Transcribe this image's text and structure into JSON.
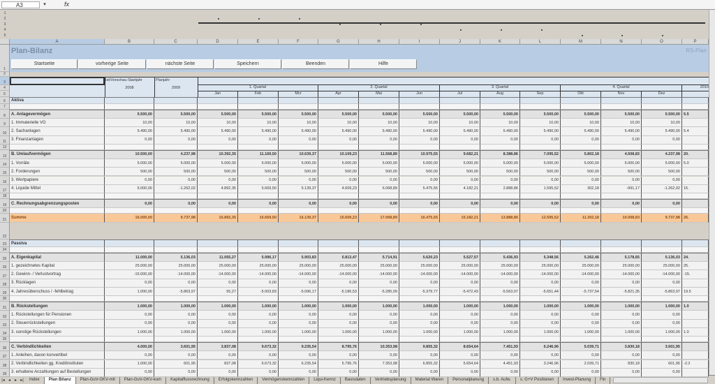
{
  "formula_bar": {
    "cell_ref": "A3",
    "dropdown_icon": "chevron-down-icon",
    "fx_label": "fx"
  },
  "outline_levels": [
    "1",
    "2",
    "3",
    "4",
    "5"
  ],
  "columns": [
    "A",
    "B",
    "C",
    "D",
    "E",
    "F",
    "G",
    "H",
    "I",
    "J",
    "K",
    "L",
    "M",
    "N",
    "O",
    "P"
  ],
  "sheet": {
    "title": "Plan-Bilanz",
    "brand": "RS-Plan",
    "buttons": [
      "Startseite",
      "vorherige Seite",
      "nächste Seite",
      "Speichern",
      "Beenden",
      "Hilfe"
    ],
    "header": {
      "col_b": "Ist/Vorschau-Startjahr",
      "col_b_year": "2008",
      "col_c": "Planjahr",
      "col_c_year": "2009",
      "quarters": [
        "1. Quartal",
        "2. Quartal",
        "3. Quartal",
        "4. Quartal"
      ],
      "months": [
        "Jan",
        "Feb",
        "Mrz",
        "Apr",
        "Mai",
        "Jun",
        "Jul",
        "Aug",
        "Sep",
        "Okt",
        "Nov",
        "Dez"
      ],
      "next_year": "2010"
    }
  },
  "rows": [
    {
      "n": "6",
      "label": "Aktiva",
      "type": "sec-title"
    },
    {
      "n": "7",
      "type": "blank"
    },
    {
      "n": "8",
      "label": "A. Anlagevermögen",
      "type": "sec",
      "values": [
        "5.500,00",
        "5.500,00",
        "5.500,00",
        "5.500,00",
        "5.500,00",
        "5.500,00",
        "5.500,00",
        "5.500,00",
        "5.500,00",
        "5.500,00",
        "5.500,00",
        "5.500,00",
        "5.500,00",
        "5.500,00"
      ],
      "p": "5.5"
    },
    {
      "n": "9",
      "label": "1. Immaterielle VG",
      "type": "plain",
      "values": [
        "10,00",
        "10,00",
        "10,00",
        "10,00",
        "10,00",
        "10,00",
        "10,00",
        "10,00",
        "10,00",
        "10,00",
        "10,00",
        "10,00",
        "10,00",
        "10,00"
      ],
      "p": ""
    },
    {
      "n": "10",
      "label": "2. Sachanlagen",
      "type": "plain",
      "values": [
        "5.490,00",
        "5.490,00",
        "5.490,00",
        "5.490,00",
        "5.490,00",
        "5.490,00",
        "5.490,00",
        "5.490,00",
        "5.490,00",
        "5.490,00",
        "5.490,00",
        "5.490,00",
        "5.490,00",
        "5.490,00"
      ],
      "p": "5.4"
    },
    {
      "n": "11",
      "label": "3. Finanzanlagen",
      "type": "plain",
      "values": [
        "0,00",
        "0,00",
        "0,00",
        "0,00",
        "0,00",
        "0,00",
        "0,00",
        "0,00",
        "0,00",
        "0,00",
        "0,00",
        "0,00",
        "0,00",
        "0,00"
      ],
      "p": ""
    },
    {
      "n": "12",
      "type": "blank"
    },
    {
      "n": "13",
      "label": "B. Umlaufvermögen",
      "type": "sec",
      "values": [
        "10.500,00",
        "4.237,98",
        "10.392,35",
        "11.169,50",
        "10.639,37",
        "10.109,23",
        "11.568,89",
        "10.975,55",
        "9.682,21",
        "8.388,86",
        "7.095,52",
        "5.802,18",
        "4.508,83",
        "4.237,98"
      ],
      "p": "20."
    },
    {
      "n": "14",
      "label": "1. Vorräte",
      "type": "plain",
      "values": [
        "5.000,00",
        "5.000,00",
        "5.000,00",
        "5.000,00",
        "5.000,00",
        "5.000,00",
        "5.000,00",
        "5.000,00",
        "5.000,00",
        "5.000,00",
        "5.000,00",
        "5.000,00",
        "5.000,00",
        "5.000,00"
      ],
      "p": "5.0"
    },
    {
      "n": "15",
      "label": "2. Forderungen",
      "type": "plain",
      "values": [
        "500,00",
        "500,00",
        "500,00",
        "500,00",
        "500,00",
        "500,00",
        "500,00",
        "500,00",
        "500,00",
        "500,00",
        "500,00",
        "500,00",
        "500,00",
        "500,00"
      ],
      "p": ""
    },
    {
      "n": "16",
      "label": "3. Wertpapiere",
      "type": "plain",
      "values": [
        "0,00",
        "0,00",
        "0,00",
        "0,00",
        "0,00",
        "0,00",
        "0,00",
        "0,00",
        "0,00",
        "0,00",
        "0,00",
        "0,00",
        "0,00",
        "0,00"
      ],
      "p": ""
    },
    {
      "n": "17",
      "label": "4. Liquide Mittel",
      "type": "plain",
      "values": [
        "5.000,00",
        "-1.262,02",
        "4.892,35",
        "5.669,50",
        "5.139,37",
        "4.609,23",
        "6.068,89",
        "5.475,55",
        "4.182,21",
        "2.888,86",
        "1.595,52",
        "302,18",
        "-991,17",
        "-1.262,02"
      ],
      "p": "15."
    },
    {
      "n": "18",
      "type": "blank"
    },
    {
      "n": "19",
      "label": "C. Rechnungsabgrenzungsposten",
      "type": "sec",
      "values": [
        "0,00",
        "0,00",
        "0,00",
        "0,00",
        "0,00",
        "0,00",
        "0,00",
        "0,00",
        "0,00",
        "0,00",
        "0,00",
        "0,00",
        "0,00",
        "0,00"
      ],
      "p": ""
    },
    {
      "n": "20",
      "type": "blank"
    },
    {
      "n": "21",
      "label": "Summe",
      "type": "sum",
      "values": [
        "16.000,00",
        "9.737,98",
        "15.892,35",
        "16.669,50",
        "16.139,37",
        "15.609,23",
        "17.068,89",
        "16.475,55",
        "15.182,21",
        "13.888,86",
        "12.595,52",
        "11.302,18",
        "10.008,83",
        "9.737,98"
      ],
      "p": "26."
    },
    {
      "n": "22",
      "type": "gap"
    },
    {
      "n": "23",
      "label": "Passiva",
      "type": "sec-title"
    },
    {
      "n": "24",
      "type": "blank"
    },
    {
      "n": "25",
      "label": "A. Eigenkapital",
      "type": "sec",
      "values": [
        "11.000,00",
        "5.136,03",
        "11.055,27",
        "5.996,17",
        "5.903,83",
        "5.813,47",
        "5.714,91",
        "5.620,23",
        "5.527,57",
        "5.436,93",
        "5.348,56",
        "5.262,46",
        "5.178,65",
        "5.136,03"
      ],
      "p": "24."
    },
    {
      "n": "26",
      "label": "1. gezeichnetes Kapital",
      "type": "plain",
      "values": [
        "25.000,00",
        "25.000,00",
        "25.000,00",
        "25.000,00",
        "25.000,00",
        "25.000,00",
        "25.000,00",
        "25.000,00",
        "25.000,00",
        "25.000,00",
        "25.000,00",
        "25.000,00",
        "25.000,00",
        "25.000,00"
      ],
      "p": "25."
    },
    {
      "n": "27",
      "label": "2. Gewinn- / Verlustvortrag",
      "type": "plain",
      "values": [
        "-15.000,00",
        "-14.000,00",
        "-14.000,00",
        "-14.000,00",
        "-14.000,00",
        "-14.000,00",
        "-14.000,00",
        "-14.000,00",
        "-14.000,00",
        "-14.000,00",
        "-14.000,00",
        "-14.000,00",
        "-14.000,00",
        "-14.000,00"
      ],
      "p": "-15."
    },
    {
      "n": "28",
      "label": "3. Rücklagen",
      "type": "plain",
      "values": [
        "0,00",
        "0,00",
        "0,00",
        "0,00",
        "0,00",
        "0,00",
        "0,00",
        "0,00",
        "0,00",
        "0,00",
        "0,00",
        "0,00",
        "0,00",
        "0,00"
      ],
      "p": ""
    },
    {
      "n": "29",
      "label": "4. Jahresüberschuss / -fehlbetrag",
      "type": "plain",
      "values": [
        "1.000,00",
        "-5.863,97",
        "55,27",
        "-5.003,83",
        "-5.096,17",
        "-5.186,53",
        "-5.285,09",
        "-5.379,77",
        "-5.472,43",
        "-5.563,07",
        "-5.651,44",
        "-5.737,54",
        "-5.821,35",
        "-5.863,97"
      ],
      "p": "19.5"
    },
    {
      "n": "30",
      "type": "blank"
    },
    {
      "n": "31",
      "label": "B. Rückstellungen",
      "type": "sec",
      "values": [
        "1.000,00",
        "1.000,00",
        "1.000,00",
        "1.000,00",
        "1.000,00",
        "1.000,00",
        "1.000,00",
        "1.000,00",
        "1.000,00",
        "1.000,00",
        "1.000,00",
        "1.000,00",
        "1.000,00",
        "1.000,00"
      ],
      "p": "1.0"
    },
    {
      "n": "32",
      "label": "1. Rückstellungen für Pensionen",
      "type": "plain",
      "values": [
        "0,00",
        "0,00",
        "0,00",
        "0,00",
        "0,00",
        "0,00",
        "0,00",
        "0,00",
        "0,00",
        "0,00",
        "0,00",
        "0,00",
        "0,00",
        "0,00"
      ],
      "p": ""
    },
    {
      "n": "33",
      "label": "2. Steuerrückstellungen",
      "type": "plain",
      "values": [
        "0,00",
        "0,00",
        "0,00",
        "0,00",
        "0,00",
        "0,00",
        "0,00",
        "0,00",
        "0,00",
        "0,00",
        "0,00",
        "0,00",
        "0,00",
        "0,00"
      ],
      "p": ""
    },
    {
      "n": "34",
      "label": "3. sonstige Rückstellungen",
      "type": "plain",
      "values": [
        "1.000,00",
        "1.000,00",
        "1.000,00",
        "1.000,00",
        "1.000,00",
        "1.000,00",
        "1.000,00",
        "1.000,00",
        "1.000,00",
        "1.000,00",
        "1.000,00",
        "1.000,00",
        "1.000,00",
        "1.000,00"
      ],
      "p": "1.0"
    },
    {
      "n": "35",
      "type": "blank"
    },
    {
      "n": "36",
      "label": "C. Verbindlichkeiten",
      "type": "sec",
      "values": [
        "4.000,00",
        "3.601,95",
        "3.837,08",
        "9.673,32",
        "9.235,54",
        "8.795,76",
        "10.353,98",
        "9.855,32",
        "8.654,64",
        "7.451,93",
        "6.246,96",
        "5.039,71",
        "3.830,18",
        "3.601,95"
      ],
      "p": ""
    },
    {
      "n": "37",
      "label": "1. Anleihen, davon konvertibel",
      "type": "plain",
      "values": [
        "0,00",
        "0,00",
        "0,00",
        "0,00",
        "0,00",
        "0,00",
        "0,00",
        "0,00",
        "0,00",
        "0,00",
        "0,00",
        "0,00",
        "0,00",
        "0,00"
      ],
      "p": ""
    },
    {
      "n": "38",
      "label": "2. Verbindlichkeiten gg. Kreditinstituten",
      "type": "plain",
      "values": [
        "1.000,00",
        "601,95",
        "837,08",
        "6.673,32",
        "6.235,54",
        "5.795,76",
        "7.353,98",
        "6.855,32",
        "5.654,64",
        "4.451,93",
        "3.246,96",
        "2.039,71",
        "830,18",
        "601,95"
      ],
      "p": "-2.2"
    },
    {
      "n": "39",
      "label": "3. erhaltene Anzahlungen auf Bestellungen",
      "type": "plain",
      "values": [
        "0,00",
        "0,00",
        "0,00",
        "0,00",
        "0,00",
        "0,00",
        "0,00",
        "0,00",
        "0,00",
        "0,00",
        "0,00",
        "0,00",
        "0,00",
        "0,00"
      ],
      "p": ""
    }
  ],
  "header_row_numbers": [
    "1",
    "2",
    "3",
    "4",
    "5"
  ],
  "tabs": [
    "Index",
    "Plan Bilanz",
    "Plan-GuV-GKV-mtl",
    "Plan-GuV-GKV-kum",
    "Kapitalflussrechnung",
    "Erfolgskennzahlen",
    "Vermögenskennzahlen",
    "Liqui-Kennz",
    "Basisdaten",
    "Vertriebsplanung",
    "Material Waren",
    "Personalplanung",
    "s.b. Aufw.",
    "s. G+V Positionen",
    "Invest-Planung",
    "Fin"
  ],
  "active_tab": "Plan Bilanz"
}
